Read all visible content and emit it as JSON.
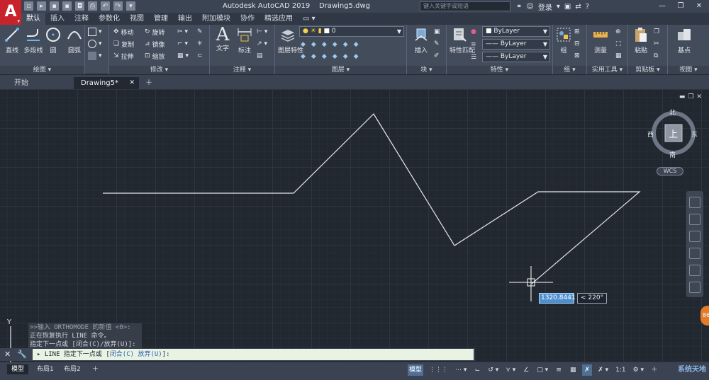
{
  "titlebar": {
    "app_logo": "A",
    "app_name": "Autodesk AutoCAD 2019",
    "document_name": "Drawing5.dwg",
    "search_placeholder": "键入关键字或短语",
    "login_label": "登录",
    "help_icon": "?"
  },
  "ribbon_tabs": [
    "默认",
    "插入",
    "注释",
    "参数化",
    "视图",
    "管理",
    "输出",
    "附加模块",
    "协作",
    "精选应用"
  ],
  "panels": {
    "draw": {
      "title": "绘图",
      "buttons": [
        "直线",
        "多段线",
        "圆",
        "圆弧"
      ]
    },
    "modify": {
      "title": "修改",
      "rows": [
        "移动",
        "旋转",
        "复制",
        "镜像",
        "拉伸",
        "缩放"
      ]
    },
    "annotation": {
      "title": "注释",
      "buttons": [
        "文字",
        "标注"
      ]
    },
    "layers": {
      "title": "图层",
      "button": "图层特性",
      "current_layer": "0"
    },
    "block": {
      "title": "块",
      "button": "插入"
    },
    "properties": {
      "title": "特性",
      "button": "特性匹配",
      "color": "ByLayer",
      "linetype": "ByLayer",
      "lineweight": "ByLayer"
    },
    "groups": {
      "title": "组",
      "button": "组"
    },
    "utilities": {
      "title": "实用工具",
      "button": "测量"
    },
    "clipboard": {
      "title": "剪贴板",
      "button": "粘贴"
    },
    "view": {
      "title": "视图",
      "button": "基点"
    }
  },
  "doc_tabs": [
    "开始",
    "Drawing5*"
  ],
  "viewcube": {
    "top_face": "上",
    "north": "北",
    "south": "南",
    "east": "东",
    "west": "西",
    "wcs": "WCS"
  },
  "dynamic_input": {
    "length": "1320.8441",
    "angle": "< 220°"
  },
  "ucs": {
    "y_label": "Y"
  },
  "command_history": [
    ">>输入 ORTHOMODE 的新值 <0>:",
    "正在恢复执行 LINE 命令。",
    "指定下一点或 [闭合(C)/放弃(U)]:"
  ],
  "command_line": {
    "prefix": "LINE 指定下一点或 [",
    "opt1": "闭合(C)",
    "opt2": "放弃(U)",
    "suffix": "]:"
  },
  "layout_tabs": [
    "模型",
    "布局1",
    "布局2"
  ],
  "status": {
    "model_label": "模型",
    "scale": "1:1",
    "watermark": "系统天地"
  },
  "side_badge": "86",
  "colors": {
    "canvas_bg": "#212830",
    "ribbon_bg": "#434c5b",
    "logo_red": "#c8232c",
    "dyn_input_blue": "#4d8fd1",
    "line_white": "#e6e9ec"
  }
}
